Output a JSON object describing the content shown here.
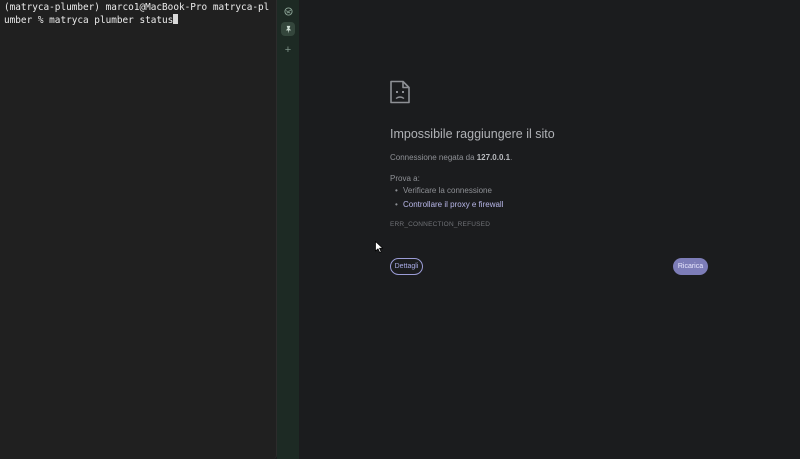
{
  "terminal": {
    "line1": "(matryca-plumber) marco1@MacBook-Pro matryca-plumber % matryca plumber status"
  },
  "tabs": {
    "items": [
      {
        "icon": "globe-icon"
      },
      {
        "icon": "pin-icon",
        "active": true
      }
    ],
    "add_label": "+"
  },
  "error_page": {
    "title": "Impossibile raggiungere il sito",
    "description_prefix": "Connessione negata da ",
    "host": "127.0.0.1",
    "description_suffix": ".",
    "try_label": "Prova a:",
    "suggestions": [
      {
        "text": "Verificare la connessione",
        "link": false
      },
      {
        "text": "Controllare il proxy e firewall",
        "link": true
      }
    ],
    "error_code": "ERR_CONNECTION_REFUSED",
    "details_button": "Dettagli",
    "reload_button": "Ricarica"
  },
  "colors": {
    "accent": "#9b9cd6",
    "reload_bg": "#7d7db8"
  }
}
